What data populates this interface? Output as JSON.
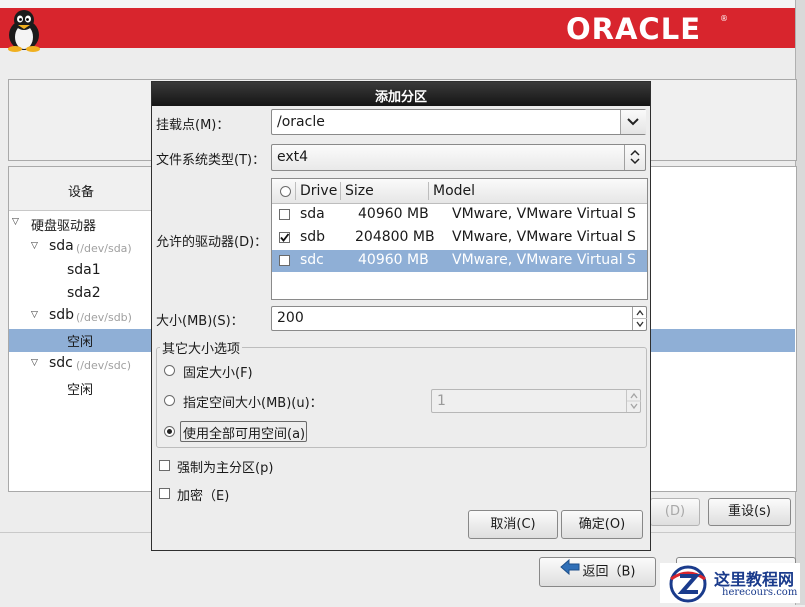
{
  "brand": {
    "logo": "ORACLE",
    "registered_mark": "®"
  },
  "background": {
    "tree_header": "设备",
    "tree": [
      {
        "label": "硬盘驱动器",
        "hint": ""
      },
      {
        "label": "sda",
        "hint": "(/dev/sda)"
      },
      {
        "label": "sda1",
        "hint": ""
      },
      {
        "label": "sda2",
        "hint": ""
      },
      {
        "label": "sdb",
        "hint": "(/dev/sdb)"
      },
      {
        "label": "空闲",
        "hint": ""
      },
      {
        "label": "sdc",
        "hint": "(/dev/sdc)"
      },
      {
        "label": "空闲",
        "hint": ""
      }
    ],
    "selected_tree_item": "空闲",
    "delete_label": "(D)",
    "reset_label": "重设(s)",
    "back_label": "返回（B)"
  },
  "dialog": {
    "title": "添加分区",
    "mount_label": "挂载点(M)：",
    "mount_value": "/oracle",
    "fstype_label": "文件系统类型(T)：",
    "fstype_value": "ext4",
    "drives_label": "允许的驱动器(D)：",
    "drive_columns": [
      "Drive",
      "Size",
      "Model"
    ],
    "drives": [
      {
        "drive": "sda",
        "size": "40960 MB",
        "model": "VMware, VMware Virtual S",
        "checked": false
      },
      {
        "drive": "sdb",
        "size": "204800 MB",
        "model": "VMware, VMware Virtual S",
        "checked": true
      },
      {
        "drive": "sdc",
        "size": "40960 MB",
        "model": "VMware, VMware Virtual S",
        "checked": false
      }
    ],
    "selected_drive": "sdc",
    "size_label": "大小(MB)(S)：",
    "size_value": "200",
    "other_size_title": "其它大小选项",
    "opt_fixed": "固定大小(F)",
    "opt_specify": "指定空间大小(MB)(u)：",
    "opt_specify_value": "1",
    "opt_useall": "使用全部可用空间(a)",
    "selected_size_option": "opt_useall",
    "force_primary": "强制为主分区(p)",
    "encrypt": "加密（E)",
    "cancel_label": "取消(C)",
    "ok_label": "确定(O)"
  },
  "watermark": {
    "title": "这里教程网",
    "url": "herecours.com"
  },
  "colors": {
    "banner_red": "#d8252d",
    "selection_blue": "#8fafd6",
    "dialog_title_bg": "#1c1c1c",
    "watermark_blue": "#1a3b8c"
  }
}
